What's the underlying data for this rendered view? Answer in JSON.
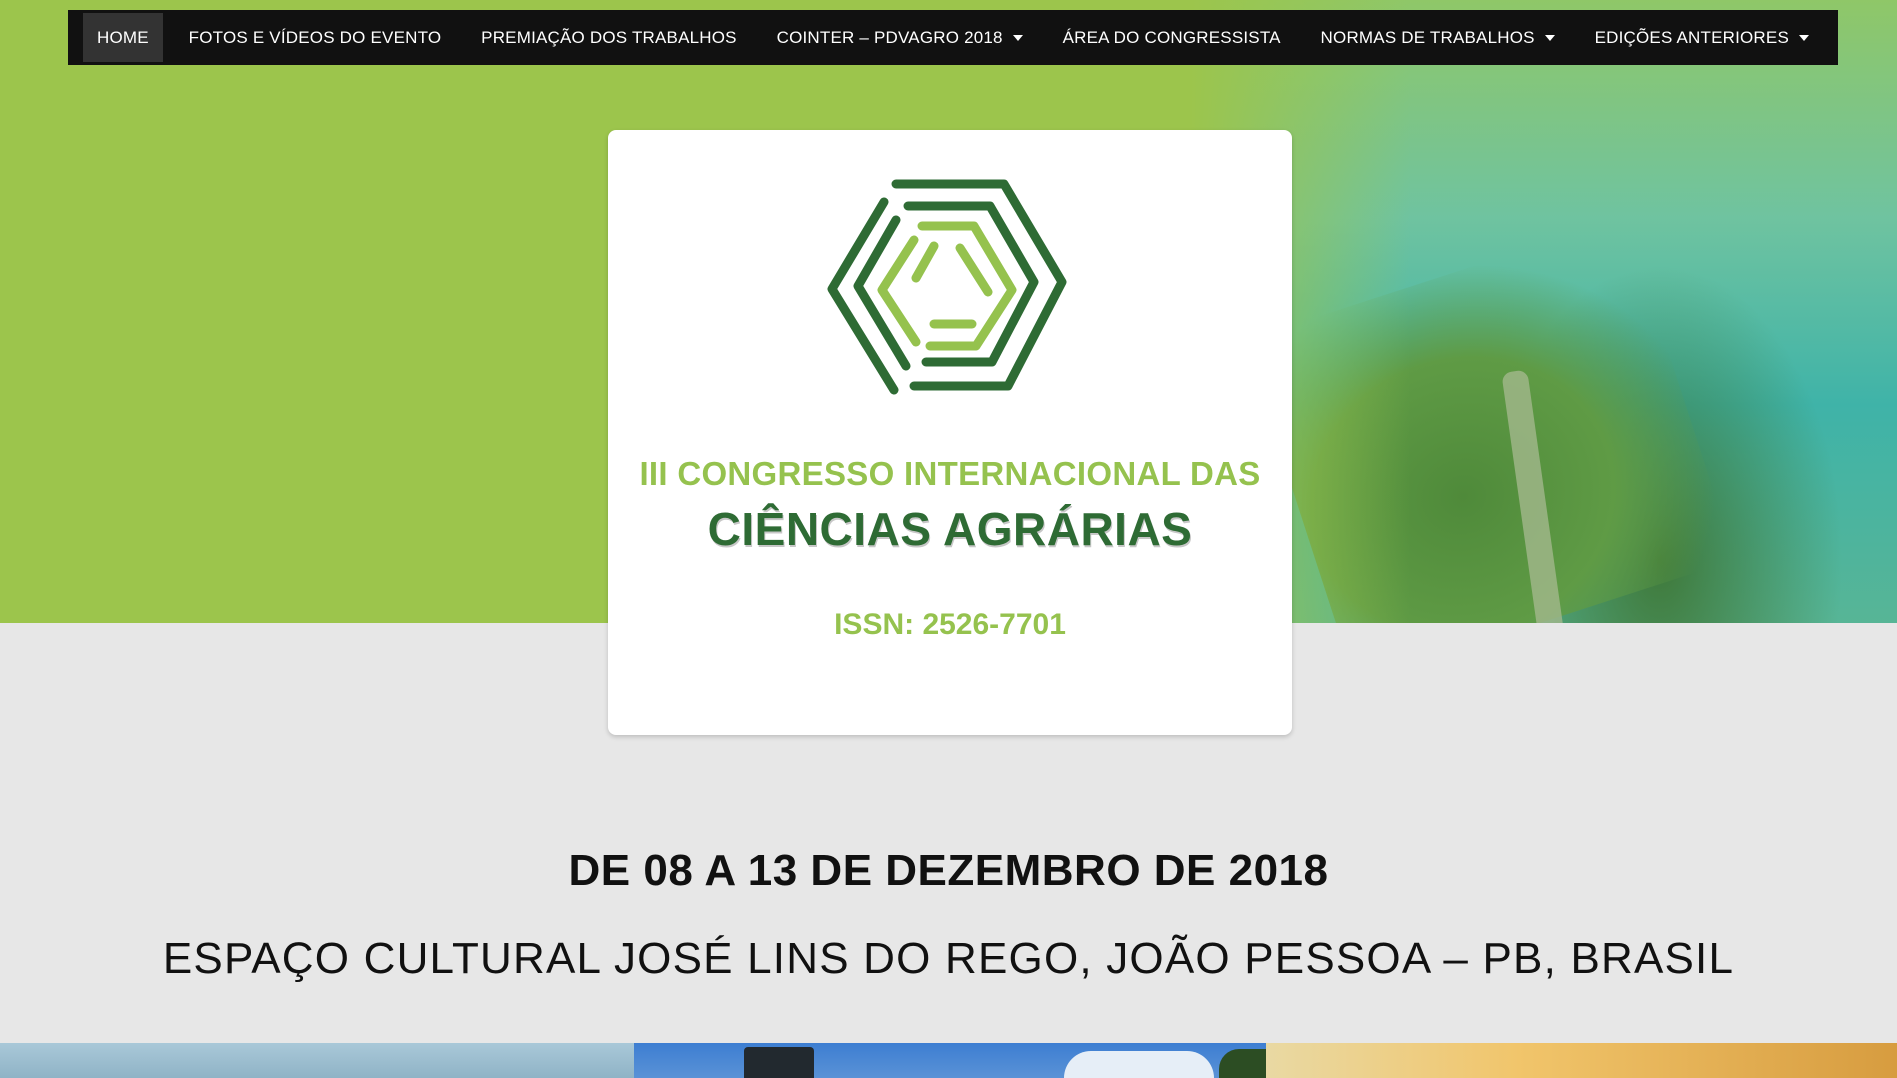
{
  "nav": {
    "items": [
      {
        "label": "HOME",
        "active": true,
        "dropdown": false
      },
      {
        "label": "FOTOS E VÍDEOS DO EVENTO",
        "active": false,
        "dropdown": false
      },
      {
        "label": "PREMIAÇÃO DOS TRABALHOS",
        "active": false,
        "dropdown": false
      },
      {
        "label": "COINTER – PDVAGRO 2018",
        "active": false,
        "dropdown": true
      },
      {
        "label": "ÁREA DO CONGRESSISTA",
        "active": false,
        "dropdown": false
      },
      {
        "label": "NORMAS DE TRABALHOS",
        "active": false,
        "dropdown": true
      },
      {
        "label": "EDIÇÕES ANTERIORES",
        "active": false,
        "dropdown": true
      }
    ]
  },
  "logo": {
    "line1": "III CONGRESSO INTERNACIONAL DAS",
    "line2": "CIÊNCIAS AGRÁRIAS",
    "issn": "ISSN: 2526-7701",
    "icon": "hexagon-maze-icon"
  },
  "event": {
    "date": "DE 08 A 13 DE DEZEMBRO DE 2018",
    "venue": "ESPAÇO CULTURAL JOSÉ LINS DO REGO, JOÃO PESSOA – PB, BRASIL"
  },
  "colors": {
    "hero_green": "#9cc54c",
    "nav_bg": "#111111",
    "logo_dark_green": "#2e6b34",
    "logo_light_green": "#95c24e",
    "page_bg": "#e7e7e7"
  }
}
